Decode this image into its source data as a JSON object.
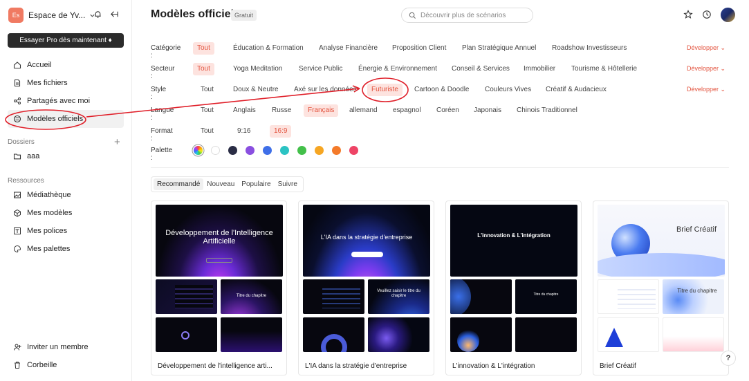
{
  "workspace": {
    "badge": "Es",
    "name": "Espace de Yv..."
  },
  "sidebar": {
    "pro_button": "Essayer Pro dès maintenant ♦",
    "nav": [
      {
        "label": "Accueil",
        "icon": "home-icon"
      },
      {
        "label": "Mes fichiers",
        "icon": "file-icon"
      },
      {
        "label": "Partagés avec moi",
        "icon": "share-icon"
      },
      {
        "label": "Modèles officiels",
        "icon": "templates-icon",
        "active": true
      }
    ],
    "folders_title": "Dossiers",
    "folders": [
      {
        "label": "aaa",
        "icon": "folder-icon"
      }
    ],
    "resources_title": "Ressources",
    "resources": [
      {
        "label": "Médiathèque",
        "icon": "image-icon"
      },
      {
        "label": "Mes modèles",
        "icon": "cube-icon"
      },
      {
        "label": "Mes polices",
        "icon": "font-icon"
      },
      {
        "label": "Mes palettes",
        "icon": "palette-icon"
      }
    ],
    "bottom": [
      {
        "label": "Inviter un membre",
        "icon": "user-plus-icon"
      },
      {
        "label": "Corbeille",
        "icon": "trash-icon"
      }
    ]
  },
  "header": {
    "title": "Modèles officiels",
    "badge": "Gratuit",
    "search_placeholder": "Découvrir plus de scénarios"
  },
  "filters": {
    "develop_label": "Développer",
    "rows": [
      {
        "label": "Catégorie :",
        "options": [
          "Tout",
          "Éducation & Formation",
          "Analyse Financière",
          "Proposition Client",
          "Plan Stratégique Annuel",
          "Roadshow Investisseurs"
        ],
        "selected": 0,
        "develop": true
      },
      {
        "label": "Secteur :",
        "options": [
          "Tout",
          "Yoga Meditation",
          "Service Public",
          "Énergie & Environnement",
          "Conseil & Services",
          "Immobilier",
          "Tourisme & Hôtellerie"
        ],
        "selected": 0,
        "develop": true
      },
      {
        "label": "Style :",
        "options": [
          "Tout",
          "Doux & Neutre",
          "Axé sur les données",
          "Futuriste",
          "Cartoon & Doodle",
          "Couleurs Vives",
          "Créatif & Audacieux"
        ],
        "selected": 3,
        "develop": true
      },
      {
        "label": "Langue :",
        "options": [
          "Tout",
          "Anglais",
          "Russe",
          "Français",
          "allemand",
          "espagnol",
          "Coréen",
          "Japonais",
          "Chinois Traditionnel"
        ],
        "selected": 3,
        "develop": false
      },
      {
        "label": "Format :",
        "options": [
          "Tout",
          "9:16",
          "16:9"
        ],
        "selected": 2,
        "develop": false
      }
    ],
    "palette_label": "Palette :",
    "palette_colors": [
      "rainbow",
      "#ffffff",
      "#2a2d45",
      "#8a4fe0",
      "#3f6fe8",
      "#2bc3c3",
      "#43c04a",
      "#f6a623",
      "#f47b2a",
      "#ee4466"
    ]
  },
  "sort_tabs": {
    "options": [
      "Recommandé",
      "Nouveau",
      "Populaire",
      "Suivre"
    ],
    "selected": 0
  },
  "cards": [
    {
      "title": "Développement de l'intelligence arti...",
      "main_text": "Développement de l'Intelligence Artificielle",
      "chapter_text": "Titre du chapitre",
      "theme": "dark"
    },
    {
      "title": "L'IA dans la stratégie d'entreprise",
      "main_text": "L'IA dans la stratégie d'entreprise",
      "chapter_text": "Veuillez saisir le titre du chapitre",
      "theme": "dark"
    },
    {
      "title": "L'innovation & L'intégration",
      "main_text": "L'innovation & L'intégration",
      "chapter_text": "Titre du chapitre",
      "theme": "dark"
    },
    {
      "title": "Brief Créatif",
      "main_text": "Brief Créatif",
      "chapter_text": "Titre du chapitre",
      "theme": "light"
    }
  ],
  "help_label": "?",
  "annotation_color": "#e0202a"
}
